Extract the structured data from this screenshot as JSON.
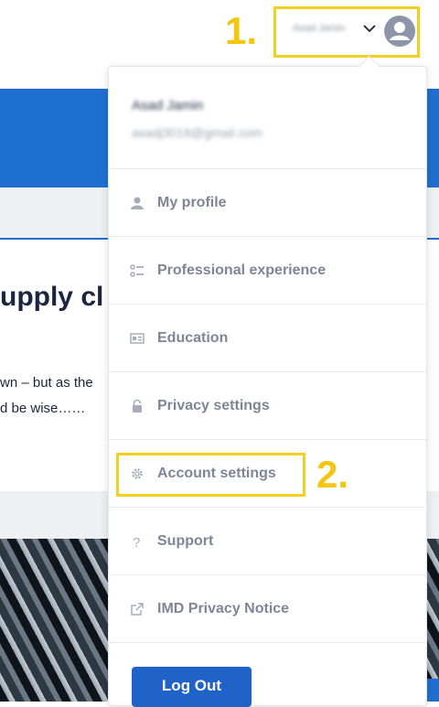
{
  "header": {
    "user_name": "Asad Jamin",
    "step1_label": "1."
  },
  "article": {
    "title_fragment": "upply cl",
    "line1": "wn – but as the",
    "line2": "d be wise……"
  },
  "dropdown": {
    "user_name": "Asad Jamin",
    "user_email": "asadj3018@gmail.com",
    "items": [
      {
        "label": "My profile",
        "icon": "person-icon"
      },
      {
        "label": "Professional experience",
        "icon": "list-icon"
      },
      {
        "label": "Education",
        "icon": "id-card-icon"
      },
      {
        "label": "Privacy settings",
        "icon": "lock-icon"
      },
      {
        "label": "Account settings",
        "icon": "gear-icon"
      },
      {
        "label": "Support",
        "icon": "question-icon"
      },
      {
        "label": "IMD Privacy Notice",
        "icon": "external-link-icon"
      }
    ],
    "logout_label": "Log Out",
    "step2_label": "2."
  },
  "colors": {
    "brand_blue": "#1f6fd1",
    "highlight_yellow": "#f5cf1f",
    "menu_text": "#7d8596"
  }
}
